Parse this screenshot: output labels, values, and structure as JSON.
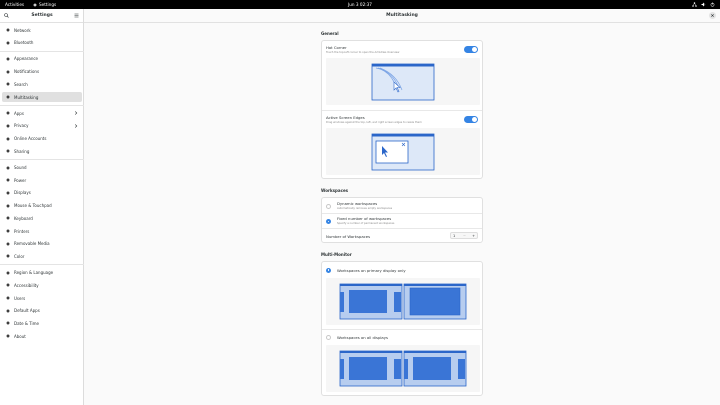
{
  "topbar": {
    "activities": "Activities",
    "app_name": "Settings",
    "clock": "Jun 3  02:37"
  },
  "sidebar": {
    "title": "Settings",
    "groups": [
      [
        {
          "label": "Network",
          "icon": "network-icon"
        },
        {
          "label": "Bluetooth",
          "icon": "bluetooth-icon"
        }
      ],
      [
        {
          "label": "Appearance",
          "icon": "appearance-icon"
        },
        {
          "label": "Notifications",
          "icon": "bell-icon"
        },
        {
          "label": "Search",
          "icon": "search-icon"
        },
        {
          "label": "Multitasking",
          "icon": "multitasking-icon",
          "selected": true
        }
      ],
      [
        {
          "label": "Apps",
          "icon": "apps-icon",
          "arrow": true
        },
        {
          "label": "Privacy",
          "icon": "hand-icon",
          "arrow": true
        },
        {
          "label": "Online Accounts",
          "icon": "accounts-icon"
        },
        {
          "label": "Sharing",
          "icon": "share-icon"
        }
      ],
      [
        {
          "label": "Sound",
          "icon": "speaker-icon"
        },
        {
          "label": "Power",
          "icon": "power-icon"
        },
        {
          "label": "Displays",
          "icon": "display-icon"
        },
        {
          "label": "Mouse & Touchpad",
          "icon": "mouse-icon"
        },
        {
          "label": "Keyboard",
          "icon": "keyboard-icon"
        },
        {
          "label": "Printers",
          "icon": "printer-icon"
        },
        {
          "label": "Removable Media",
          "icon": "media-icon"
        },
        {
          "label": "Color",
          "icon": "color-icon"
        }
      ],
      [
        {
          "label": "Region & Language",
          "icon": "flag-icon"
        },
        {
          "label": "Accessibility",
          "icon": "accessibility-icon"
        },
        {
          "label": "Users",
          "icon": "users-icon"
        },
        {
          "label": "Default Apps",
          "icon": "star-icon"
        },
        {
          "label": "Date & Time",
          "icon": "clock-icon"
        },
        {
          "label": "About",
          "icon": "info-icon"
        }
      ]
    ]
  },
  "main": {
    "title": "Multitasking",
    "general": {
      "heading": "General",
      "hot_corner": {
        "title": "Hot Corner",
        "subtitle": "Touch the top-left corner to open the Activities Overview",
        "enabled": true
      },
      "screen_edges": {
        "title": "Active Screen Edges",
        "subtitle": "Drag windows against the top, left, and right screen edges to resize them",
        "enabled": true
      }
    },
    "workspaces": {
      "heading": "Workspaces",
      "dynamic": {
        "title": "Dynamic workspaces",
        "subtitle": "Automatically removes empty workspaces",
        "selected": false
      },
      "fixed": {
        "title": "Fixed number of workspaces",
        "subtitle": "Specify a number of permanent workspaces",
        "selected": true
      },
      "number_label": "Number of Workspaces",
      "number_value": "1",
      "minus": "−",
      "plus": "+"
    },
    "multi_monitor": {
      "heading": "Multi-Monitor",
      "primary_only": {
        "title": "Workspaces on primary display only",
        "selected": true
      },
      "all_displays": {
        "title": "Workspaces on all displays",
        "selected": false
      }
    }
  },
  "colors": {
    "accent": "#3584e4",
    "illus_light": "#b7cdef",
    "illus_dark": "#2b66c9"
  }
}
